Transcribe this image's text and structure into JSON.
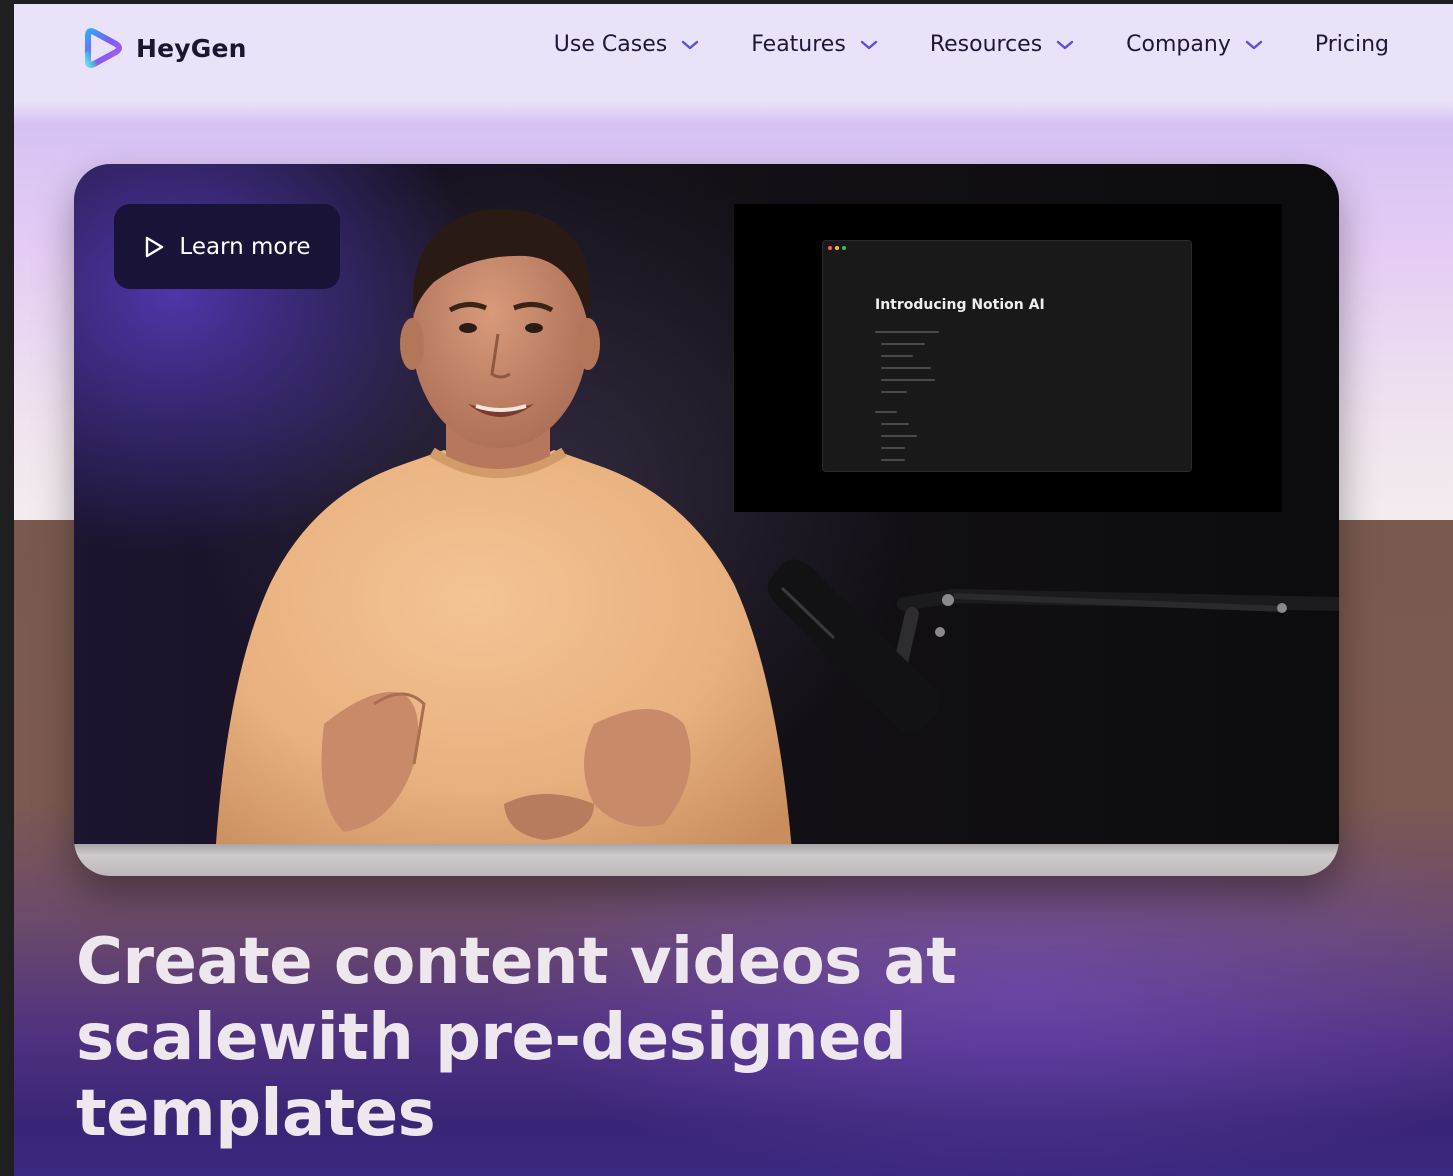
{
  "brand": {
    "name": "HeyGen"
  },
  "nav": {
    "items": [
      {
        "label": "Use Cases",
        "has_dropdown": true
      },
      {
        "label": "Features",
        "has_dropdown": true
      },
      {
        "label": "Resources",
        "has_dropdown": true
      },
      {
        "label": "Company",
        "has_dropdown": true
      },
      {
        "label": "Pricing",
        "has_dropdown": false
      }
    ]
  },
  "hero": {
    "learn_more_label": "Learn more",
    "screen_title": "Introducing Notion AI",
    "headline_lines": [
      "Create content videos at",
      "scalewith pre-designed",
      "templates"
    ]
  },
  "icons": {
    "logo": "heygen-logo-icon",
    "dropdown": "chevron-down-icon",
    "play": "play-icon"
  },
  "colors": {
    "header_bg": "#e9e2f8",
    "nav_text": "#1e1838",
    "accent_chevron": "#5b4fd6",
    "button_bg": "#1a1338",
    "headline_text": "#efe7ee"
  }
}
